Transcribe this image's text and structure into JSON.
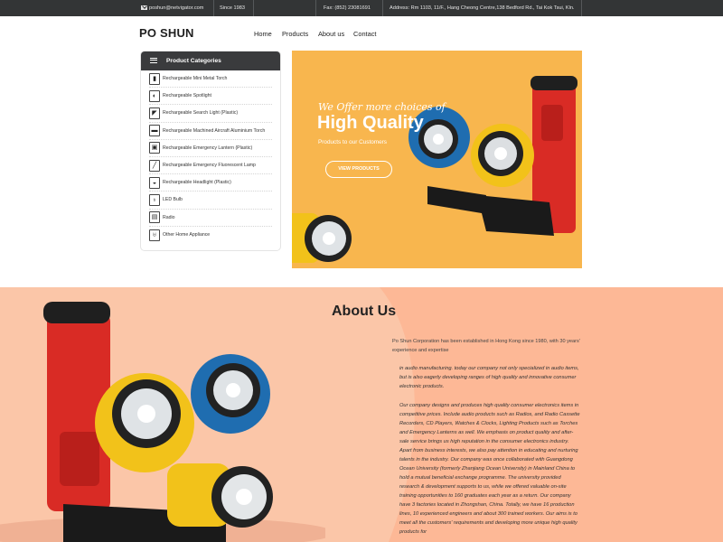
{
  "topbar": {
    "email": "poshun@netvigator.com",
    "since": "Since 1983",
    "fax": "Fax: (852) 23081691",
    "address": "Address: Rm 1103, 11/F., Hang Cheong Centre,138 Bedford Rd., Tai Kok Tsui, Kln."
  },
  "header": {
    "logo": "PO SHUN",
    "nav": [
      "Home",
      "Products",
      "About us",
      "Contact"
    ]
  },
  "sidebar": {
    "title": "Product Categories",
    "items": [
      {
        "label": "Rechargeable Mini Metal Torch",
        "icon": "torch-icon"
      },
      {
        "label": "Rechargeable Spotlight",
        "icon": "spotlight-icon"
      },
      {
        "label": "Rechargeable Search Light (Plastic)",
        "icon": "search-light-icon"
      },
      {
        "label": "Rechargeable Machined Aircraft Aluminium Torch",
        "icon": "aluminium-torch-icon"
      },
      {
        "label": "Rechargeable Emergency Lantern (Plastic)",
        "icon": "lantern-icon"
      },
      {
        "label": "Rechargeable Emergency Fluorescent Lamp",
        "icon": "fluorescent-lamp-icon"
      },
      {
        "label": "Rechargeable Headlight (Plastic)",
        "icon": "headlight-icon"
      },
      {
        "label": "LED Bulb",
        "icon": "bulb-icon"
      },
      {
        "label": "Radio",
        "icon": "radio-icon"
      },
      {
        "label": "Other Home Appliance",
        "icon": "appliance-icon"
      }
    ]
  },
  "banner": {
    "subtitle": "We Offer more choices of",
    "title": "High Quality",
    "tagline": "Products to our Customers",
    "button": "VIEW PRODUCTS"
  },
  "about": {
    "title": "About Us",
    "intro": "Po Shun Corporation has been established in Hong Kong since 1980, with 30 years' experience and expertise",
    "para1": "in audio manufacturing. today our company not only specialized in audio items, but is also eagerly developing ranges of high quality and innovative consumer electronic products.",
    "para2": "Our company designs and produces high quality consumer electronics items in competitive prices. Include audio products such as Radios, and Radio Cassette Recorders, CD Players, Watches & Clocks, Lighting Products such as Torches and Emergency Lanterns as well. We emphasis on product quality and after-sale service brings us high reputation in the consumer electronics industry. Apart from business interests, we also pay attention in educating and nurturing talents in the industry. Our company was once collaborated with Guangdong Ocean University (formerly Zhanjiang Ocean University) in Mainland China to hold a mutual beneficial exchange programme. The university provided research & development supports to us, while we offered valuable on-site training opportunities to 160 graduates each year as a return. Our company have 3 factories located in Zhongshan, China. Totally, we have 16 production lines, 10 experienced engineers and about 300 trained workers. Our aims is to meet all the customers' requirements and developing more unique high quality products for"
  },
  "colors": {
    "topbar": "#333536",
    "banner": "#f8b64e",
    "about_bg": "#fdb896",
    "torch_red": "#d92b25",
    "torch_blue": "#1f6db0",
    "torch_yellow": "#f2c21a"
  }
}
